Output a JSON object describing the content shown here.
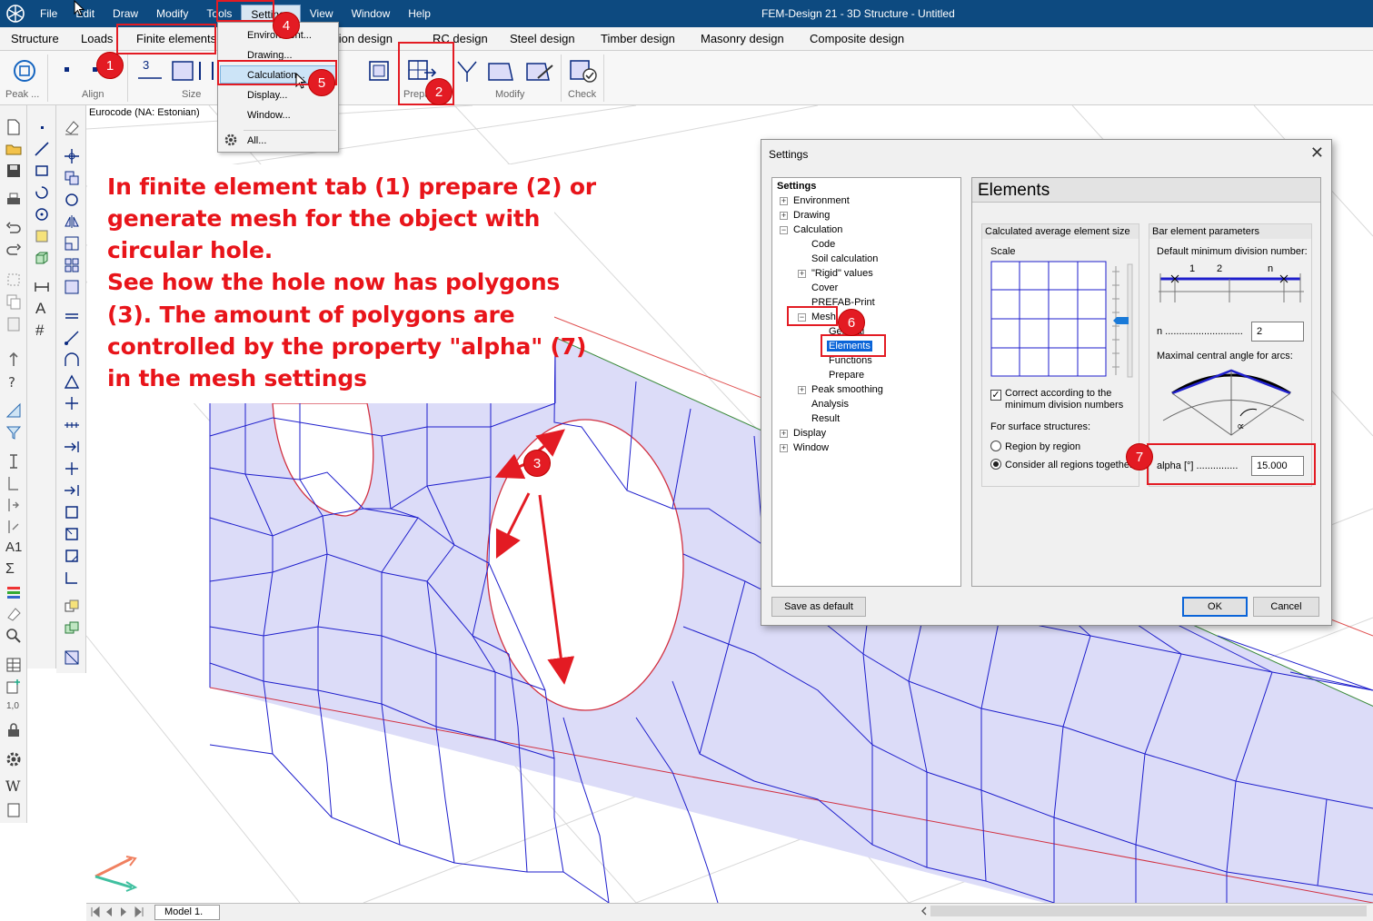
{
  "app": {
    "title": "FEM-Design 21 - 3D Structure - Untitled",
    "menu": [
      "File",
      "Edit",
      "Draw",
      "Modify",
      "Tools",
      "Settings",
      "View",
      "Window",
      "Help"
    ],
    "tabs": [
      "Structure",
      "Loads",
      "Finite elements",
      "Foundation design",
      "RC design",
      "Steel design",
      "Timber design",
      "Masonry design",
      "Composite design"
    ],
    "ribbon_groups": [
      "Peak ...",
      "Align",
      "Size",
      "Prepare",
      "Modify",
      "Check"
    ],
    "ribbon_size_value": "3",
    "code_label": "Eurocode (NA: Estonian)",
    "model_tab": "Model 1.",
    "left_toolbar_text": [
      "A",
      "#",
      "A1",
      "Σ",
      "1,0",
      "W"
    ]
  },
  "settings_menu": {
    "items": [
      "Environment...",
      "Drawing...",
      "Calculation...",
      "Display...",
      "Window...",
      "All..."
    ],
    "highlighted": "Calculation..."
  },
  "annotation": {
    "lines": [
      "In finite element tab (1) prepare (2) or",
      "generate mesh for the object with",
      "circular hole.",
      "See how the hole now has polygons",
      "(3). The amount of polygons are",
      "controlled by the property \"alpha\" (7)",
      "in the mesh settings"
    ],
    "badges": [
      "1",
      "2",
      "3",
      "4",
      "5",
      "6",
      "7"
    ],
    "color": "#e31b23"
  },
  "dialog": {
    "title": "Settings",
    "tree": {
      "root": "Settings",
      "items": [
        "Environment",
        "Drawing",
        "Calculation",
        "Code",
        "Soil calculation",
        "\"Rigid\" values",
        "Cover",
        "PREFAB-Print",
        "Mesh",
        "General",
        "Elements",
        "Functions",
        "Prepare",
        "Peak smoothing",
        "Analysis",
        "Result",
        "Display",
        "Window"
      ],
      "selected": "Elements"
    },
    "panel_title": "Elements",
    "avg_group": {
      "title": "Calculated average element size",
      "scale_label": "Scale",
      "correct_label_1": "Correct according to the",
      "correct_label_2": "minimum division numbers",
      "surface_label": "For surface structures:",
      "radio_region": "Region by region",
      "radio_all": "Consider all regions together"
    },
    "bar_group": {
      "title": "Bar element parameters",
      "default_div_label": "Default minimum division number:",
      "div_ticks": [
        "1",
        "2",
        "n"
      ],
      "n_label": "n ............................",
      "n_value": "2",
      "max_angle_label": "Maximal central angle for arcs:",
      "alpha_symbol": "∝",
      "alpha_label": "alpha [°] ...............",
      "alpha_value": "15.000"
    },
    "buttons": {
      "save_default": "Save as default",
      "ok": "OK",
      "cancel": "Cancel"
    },
    "close_glyph": "✕"
  },
  "colors": {
    "titlebar": "#0d4a80",
    "mesh_fill": "#dcdcf8",
    "mesh_line": "#1e1ecc",
    "accent_red": "#e31b23",
    "selection": "#0a64d8"
  }
}
